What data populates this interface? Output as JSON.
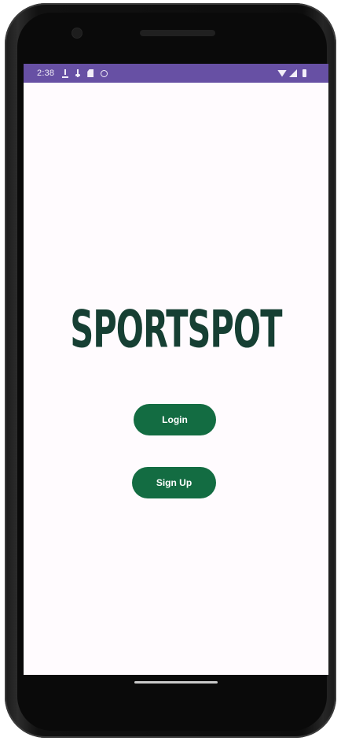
{
  "status_bar": {
    "time": "2:38",
    "background_color": "#6750a4",
    "left_icons": [
      "download-icon",
      "usb-icon",
      "sd-card-icon",
      "circle-icon"
    ],
    "right_icons": [
      "wifi-icon",
      "signal-icon",
      "battery-icon"
    ]
  },
  "app": {
    "brand_name": "SPORTSPOT",
    "brand_color": "#163f33"
  },
  "buttons": {
    "login_label": "Login",
    "signup_label": "Sign Up",
    "color": "#136c42"
  }
}
